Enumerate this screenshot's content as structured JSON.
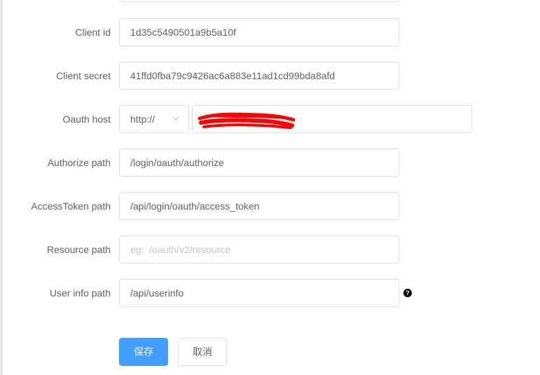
{
  "form": {
    "client_id": {
      "label": "Client id",
      "value": "1d35c5490501a9b5a10f"
    },
    "client_secret": {
      "label": "Client secret",
      "value": "41ffd0fba79c9426ac6a883e11ad1cd99bda8afd"
    },
    "oauth_host": {
      "label": "Oauth host",
      "protocol": "http://",
      "value": ""
    },
    "authorize_path": {
      "label": "Authorize path",
      "value": "/login/oauth/authorize"
    },
    "access_token_path": {
      "label": "AccessToken path",
      "value": "/api/login/oauth/access_token"
    },
    "resource_path": {
      "label": "Resource path",
      "value": "",
      "placeholder": "eg:  /oauth/v2/resource"
    },
    "user_info_path": {
      "label": "User info path",
      "value": "/api/userinfo",
      "help_glyph": "?"
    }
  },
  "buttons": {
    "save_label": "保存",
    "cancel_label": "取消"
  },
  "colors": {
    "primary": "#409eff",
    "border": "#dcdfe6",
    "label": "#606266",
    "placeholder": "#c0c4cc",
    "redaction": "#ff0000"
  }
}
